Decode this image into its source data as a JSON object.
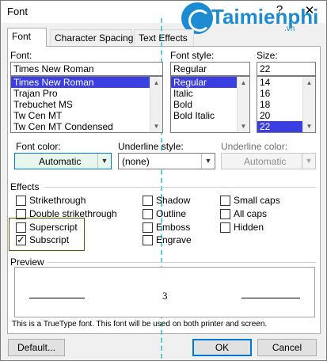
{
  "window": {
    "title": "Font",
    "help_glyph": "?",
    "close_glyph": "✕"
  },
  "logo": {
    "text": "Taimienphi",
    "sub": ".vn"
  },
  "tabs": [
    {
      "label": "Font",
      "active": true
    },
    {
      "label": "Character Spacing"
    },
    {
      "label": "Text Effects"
    }
  ],
  "font": {
    "label": "Font:",
    "value": "Times New Roman",
    "items": [
      "Times New Roman",
      "Trajan Pro",
      "Trebuchet MS",
      "Tw Cen MT",
      "Tw Cen MT Condensed"
    ],
    "selected": "Times New Roman"
  },
  "font_style": {
    "label": "Font style:",
    "value": "Regular",
    "items": [
      "Regular",
      "Italic",
      "Bold",
      "Bold Italic"
    ],
    "selected": "Regular"
  },
  "size": {
    "label": "Size:",
    "value": "22",
    "items": [
      "14",
      "16",
      "18",
      "20",
      "22"
    ],
    "selected": "22"
  },
  "font_color": {
    "label": "Font color:",
    "value": "Automatic"
  },
  "underline_style": {
    "label": "Underline style:",
    "value": "(none)"
  },
  "underline_color": {
    "label": "Underline color:",
    "value": "Automatic"
  },
  "effects": {
    "label": "Effects",
    "col1": [
      {
        "label": "Strikethrough",
        "checked": false
      },
      {
        "label": "Double strikethrough",
        "checked": false
      },
      {
        "label": "Superscript",
        "checked": false
      },
      {
        "label": "Subscript",
        "checked": true
      }
    ],
    "col2": [
      {
        "label": "Shadow",
        "checked": false
      },
      {
        "label": "Outline",
        "checked": false
      },
      {
        "label": "Emboss",
        "checked": false
      },
      {
        "label": "Engrave",
        "checked": false
      }
    ],
    "col3": [
      {
        "label": "Small caps",
        "checked": false
      },
      {
        "label": "All caps",
        "checked": false
      },
      {
        "label": "Hidden",
        "checked": false
      }
    ]
  },
  "preview": {
    "label": "Preview",
    "text": "3"
  },
  "note": "This is a TrueType font. This font will be used on both printer and screen.",
  "buttons": {
    "default": "Default...",
    "ok": "OK",
    "cancel": "Cancel"
  },
  "colors": {
    "selection": "#3b3ee0",
    "accent": "#0078d7",
    "font_color_swatch": "#22c38a"
  }
}
